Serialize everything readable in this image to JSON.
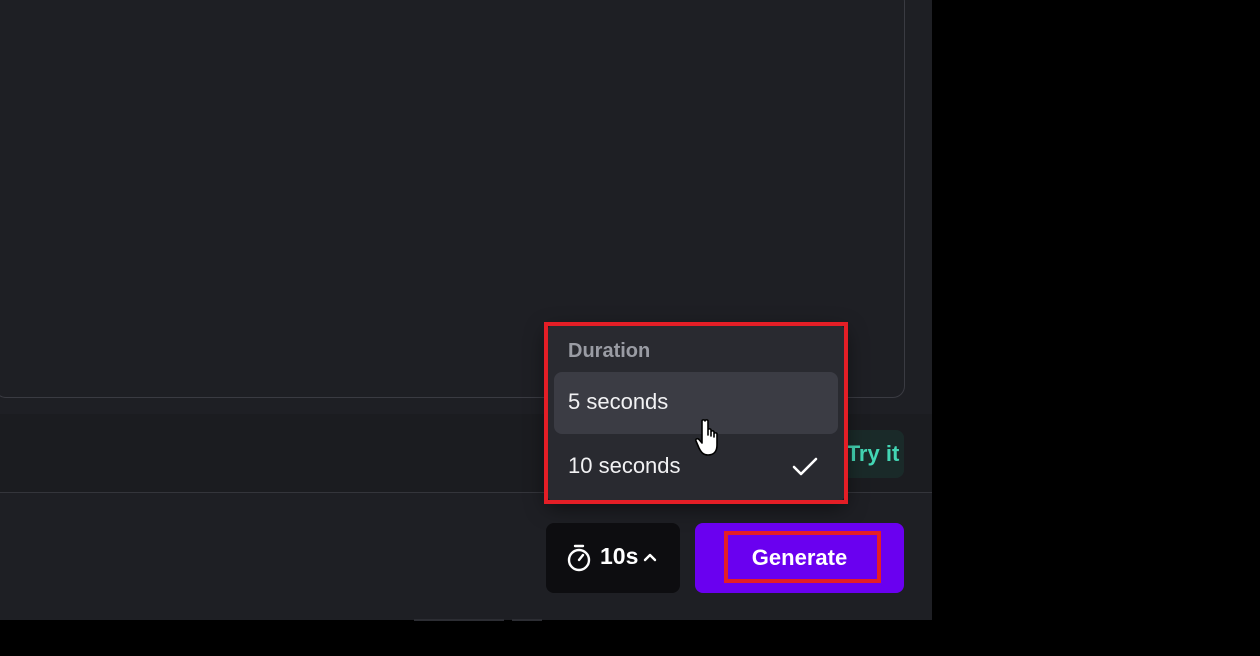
{
  "duration_menu": {
    "header": "Duration",
    "options": [
      {
        "label": "5 seconds",
        "selected": false
      },
      {
        "label": "10 seconds",
        "selected": true
      }
    ]
  },
  "hint_strip": {
    "action_label": "Try it"
  },
  "toolbar": {
    "duration_value": "10s",
    "generate_label": "Generate"
  },
  "icons": {
    "timer": "stopwatch-icon",
    "chevron": "chevron-up-icon",
    "check": "check-icon",
    "cursor": "hand-pointer-cursor"
  },
  "colors": {
    "background": "#1e1f24",
    "menu_background": "#292a30",
    "generate_button": "#6a00f0",
    "try_it_text": "#43d6b4",
    "highlight": "#e41e26"
  }
}
